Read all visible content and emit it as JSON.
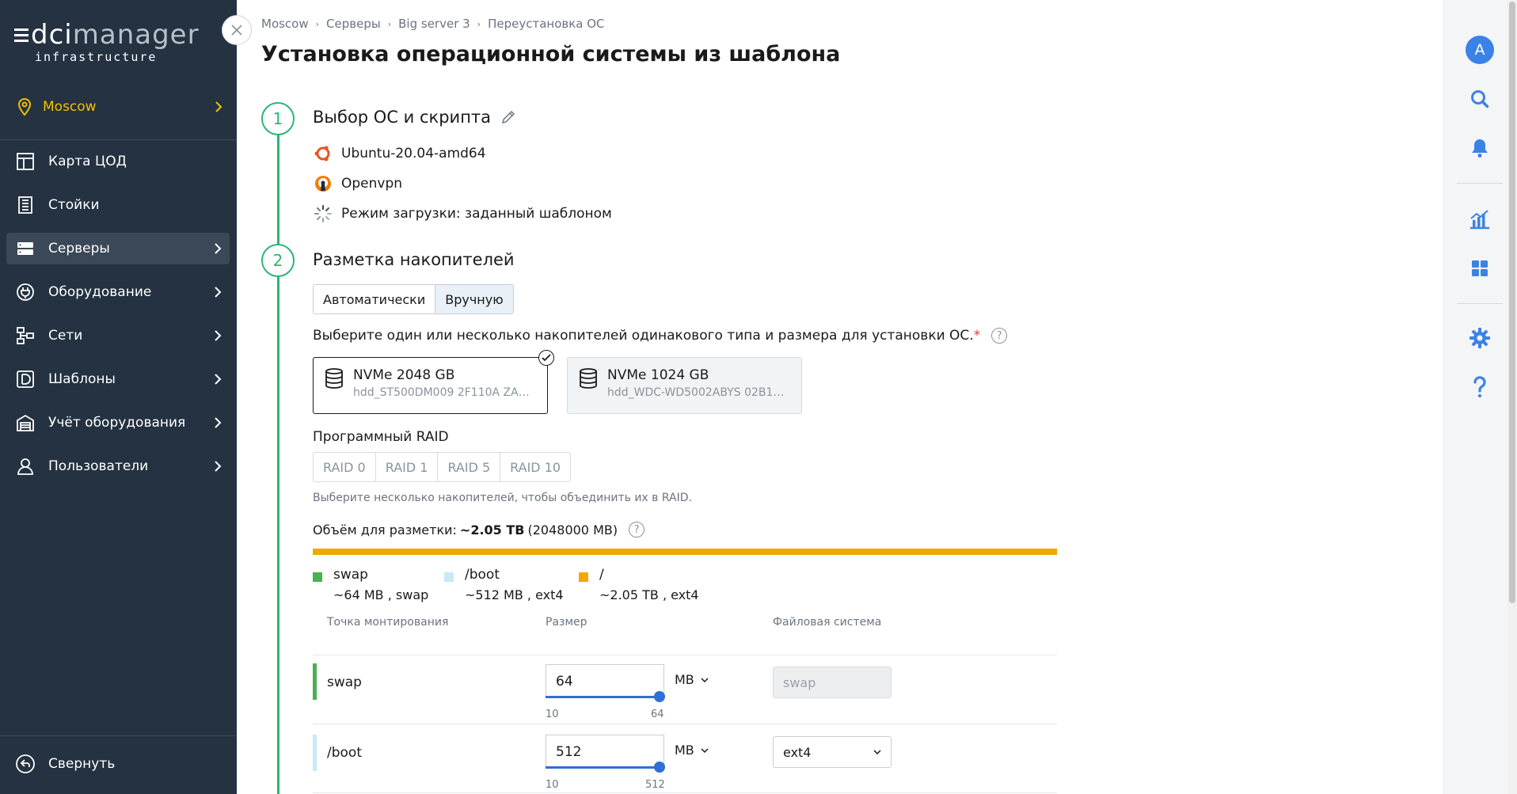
{
  "brand": {
    "logo_word_a": "dci",
    "logo_word_b": "manager",
    "logo_sub": "infrastructure"
  },
  "location": {
    "label": "Moscow"
  },
  "menu": [
    {
      "label": "Карта ЦОД",
      "icon": "map-icon"
    },
    {
      "label": "Стойки",
      "icon": "rack-icon"
    },
    {
      "label": "Серверы",
      "icon": "server-icon",
      "active": true
    },
    {
      "label": "Оборудование",
      "icon": "plug-icon"
    },
    {
      "label": "Сети",
      "icon": "network-icon"
    },
    {
      "label": "Шаблоны",
      "icon": "template-icon"
    },
    {
      "label": "Учёт оборудования",
      "icon": "warehouse-icon"
    },
    {
      "label": "Пользователи",
      "icon": "user-icon"
    }
  ],
  "collapse_label": "Свернуть",
  "breadcrumbs": [
    "Moscow",
    "Серверы",
    "Big server 3",
    "Переустановка ОС"
  ],
  "page_title": "Установка операционной системы из шаблона",
  "step1": {
    "number": "1",
    "title": "Выбор ОС и скрипта",
    "os": "Ubuntu-20.04-amd64",
    "script": "Openvpn",
    "boot_mode": "Режим загрузки: заданный шаблоном"
  },
  "step2": {
    "number": "2",
    "title": "Разметка накопителей",
    "mode_auto": "Автоматически",
    "mode_manual": "Вручную",
    "instruction": "Выберите один или несколько накопителей одинакового типа и размера для установки ОС.",
    "required_mark": "*",
    "help_mark": "?",
    "disks": [
      {
        "name": "NVMe 2048 GB",
        "serial": "hdd_ST500DM009 2F110A ZA48...",
        "selected": true
      },
      {
        "name": "NVMe 1024 GB",
        "serial": "hdd_WDC-WD5002ABYS 02B1B ...",
        "selected": false
      }
    ],
    "raid_label": "Программный RAID",
    "raid_options": [
      "RAID 0",
      "RAID 1",
      "RAID 5",
      "RAID 10"
    ],
    "raid_hint": "Выберите несколько накопителей, чтобы объединить их в RAID.",
    "volume_label": "Объём для разметки:",
    "volume_value": "~2.05 TB",
    "volume_exact": "(2048000 MB)",
    "legend": [
      {
        "name": "swap",
        "detail": "~64 MB , swap",
        "color": "#4caf50"
      },
      {
        "name": "/boot",
        "detail": "~512 MB , ext4",
        "color": "#c8e9f7"
      },
      {
        "name": "/",
        "detail": "~2.05 TB , ext4",
        "color": "#f0a800"
      }
    ],
    "columns": {
      "mount": "Точка монтирования",
      "size": "Размер",
      "fs": "Файловая система"
    },
    "partitions": [
      {
        "mount": "swap",
        "size": "64",
        "unit": "MB",
        "min": "10",
        "max": "64",
        "fs": "swap",
        "fs_editable": false,
        "color": "#4caf50"
      },
      {
        "mount": "/boot",
        "size": "512",
        "unit": "MB",
        "min": "10",
        "max": "512",
        "fs": "ext4",
        "fs_editable": true,
        "color": "#c8e9f7"
      }
    ]
  },
  "rail": {
    "avatar_letter": "A"
  }
}
